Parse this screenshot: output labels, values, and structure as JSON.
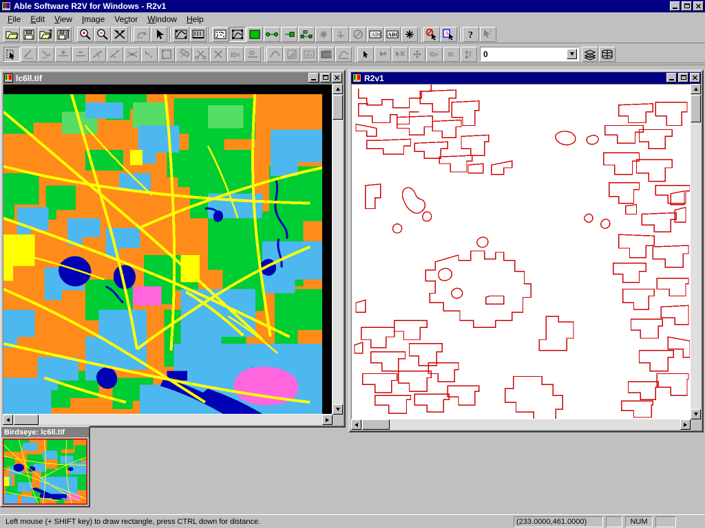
{
  "app": {
    "title": "Able Software R2V for Windows - R2v1",
    "icon": "app-icon",
    "window_buttons": {
      "minimize": "_",
      "maximize": "□",
      "close": "✕"
    }
  },
  "menu": {
    "items": [
      {
        "label": "File",
        "accel": "F"
      },
      {
        "label": "Edit",
        "accel": "E"
      },
      {
        "label": "View",
        "accel": "V"
      },
      {
        "label": "Image",
        "accel": "I"
      },
      {
        "label": "Vector",
        "accel": "c"
      },
      {
        "label": "Window",
        "accel": "W"
      },
      {
        "label": "Help",
        "accel": "H"
      }
    ]
  },
  "toolbar_row1": {
    "buttons": [
      {
        "name": "open-image-button",
        "icon": "open-folder-icon",
        "state": "enabled"
      },
      {
        "name": "save-image-button",
        "icon": "floppy-disk-icon",
        "state": "enabled"
      },
      {
        "name": "open-vector-button",
        "icon": "open-folder-vector-icon",
        "state": "enabled"
      },
      {
        "name": "save-vector-button",
        "icon": "floppy-disk-vector-icon",
        "state": "enabled"
      },
      {
        "name": "sep1",
        "icon": "separator"
      },
      {
        "name": "zoom-in-button",
        "icon": "magnifier-plus-icon",
        "state": "enabled"
      },
      {
        "name": "zoom-out-button",
        "icon": "magnifier-minus-icon",
        "state": "enabled"
      },
      {
        "name": "zoom-fit-button",
        "icon": "zoom-fit-icon",
        "state": "enabled"
      },
      {
        "name": "sep2",
        "icon": "separator"
      },
      {
        "name": "undo-button",
        "icon": "undo-arrow-icon",
        "state": "disabled"
      },
      {
        "name": "pointer-select-button",
        "icon": "arrow-pointer-icon",
        "state": "enabled"
      },
      {
        "name": "sep3",
        "icon": "separator"
      },
      {
        "name": "auto-vectorize-button",
        "icon": "vectorize-icon",
        "state": "enabled"
      },
      {
        "name": "raster-editing-button",
        "icon": "raster-edit-icon",
        "state": "enabled"
      },
      {
        "name": "sep4",
        "icon": "separator"
      },
      {
        "name": "show-raster-button",
        "icon": "raster-dots-icon",
        "state": "enabled"
      },
      {
        "name": "show-vector-button",
        "icon": "vector-frame-icon",
        "state": "pressed"
      },
      {
        "name": "show-color-button",
        "icon": "green-square-icon",
        "state": "enabled"
      },
      {
        "name": "show-lines-button",
        "icon": "line-nodes-icon",
        "state": "enabled"
      },
      {
        "name": "show-single-line-button",
        "icon": "single-node-icon",
        "state": "enabled"
      },
      {
        "name": "show-line-id-button",
        "icon": "line-id-icon",
        "state": "enabled"
      },
      {
        "name": "show-points-button",
        "icon": "points-icon",
        "state": "disabled"
      },
      {
        "name": "show-control-points-button",
        "icon": "control-point-icon",
        "state": "disabled"
      },
      {
        "name": "no-entry-button",
        "icon": "no-entry-icon",
        "state": "disabled"
      },
      {
        "name": "show-text-button",
        "icon": "text-box-icon",
        "state": "enabled"
      },
      {
        "name": "show-abc-button",
        "icon": "abc-icon",
        "state": "enabled"
      },
      {
        "name": "show-node-button",
        "icon": "star-node-icon",
        "state": "enabled"
      },
      {
        "name": "sep5",
        "icon": "separator"
      },
      {
        "name": "delete-select-button",
        "icon": "delete-pointer-icon",
        "state": "enabled"
      },
      {
        "name": "attribute-select-button",
        "icon": "attribute-pointer-icon",
        "state": "enabled"
      },
      {
        "name": "sep6",
        "icon": "separator"
      },
      {
        "name": "help-button",
        "icon": "question-mark-icon",
        "state": "enabled"
      },
      {
        "name": "context-help-button",
        "icon": "arrow-question-icon",
        "state": "disabled"
      }
    ]
  },
  "toolbar_row2": {
    "buttons": [
      {
        "name": "edit-select-tool",
        "icon": "hand-pointer-icon",
        "state": "pressed"
      },
      {
        "name": "draw-line-tool",
        "icon": "draw-line-icon",
        "state": "disabled"
      },
      {
        "name": "add-vertex-tool",
        "icon": "add-vertex-icon",
        "state": "disabled"
      },
      {
        "name": "add-node-tool",
        "icon": "add-node-plus-icon",
        "state": "disabled"
      },
      {
        "name": "delete-node-tool",
        "icon": "delete-node-minus-icon",
        "state": "disabled"
      },
      {
        "name": "split-line-tool",
        "icon": "split-line-icon",
        "state": "disabled"
      },
      {
        "name": "join-line-tool",
        "icon": "join-line-icon",
        "state": "disabled"
      },
      {
        "name": "connect-lines-tool",
        "icon": "connect-lines-icon",
        "state": "disabled"
      },
      {
        "name": "move-line-tool",
        "icon": "move-line-icon",
        "state": "disabled"
      },
      {
        "name": "close-polygon-tool",
        "icon": "polygon-icon",
        "state": "disabled"
      },
      {
        "name": "measure-tool",
        "icon": "measure-icon",
        "state": "disabled"
      },
      {
        "name": "cut-line-tool",
        "icon": "scissors-icon",
        "state": "disabled"
      },
      {
        "name": "delete-line-tool",
        "icon": "x-delete-icon",
        "state": "disabled"
      },
      {
        "name": "set-id-tool",
        "icon": "id-equals-icon",
        "state": "disabled"
      },
      {
        "name": "id-label-tool",
        "icon": "id-label-icon",
        "state": "disabled"
      },
      {
        "name": "sep1",
        "icon": "separator"
      },
      {
        "name": "smooth-line-tool",
        "icon": "smooth-line-icon",
        "state": "disabled"
      },
      {
        "name": "hatch-tool",
        "icon": "hatch-icon",
        "state": "disabled"
      },
      {
        "name": "text-tool",
        "icon": "abc-text-icon",
        "state": "disabled"
      },
      {
        "name": "fill-tool",
        "icon": "fill-region-icon",
        "state": "disabled"
      },
      {
        "name": "contour-tool",
        "icon": "contour-icon",
        "state": "disabled"
      },
      {
        "name": "sep2",
        "icon": "separator"
      },
      {
        "name": "point-select-tool",
        "icon": "small-pointer-icon",
        "state": "enabled"
      },
      {
        "name": "add-point-tool",
        "icon": "add-point-icon",
        "state": "disabled"
      },
      {
        "name": "delete-point-tool",
        "icon": "delete-point-icon",
        "state": "disabled"
      },
      {
        "name": "move-point-tool",
        "icon": "move-point-icon",
        "state": "disabled"
      },
      {
        "name": "point-id-tool",
        "icon": "point-id-equals-icon",
        "state": "disabled"
      },
      {
        "name": "point-label-tool",
        "icon": "point-id-icon",
        "state": "disabled"
      },
      {
        "name": "point-attr-tool",
        "icon": "point-attribute-icon",
        "state": "disabled"
      }
    ],
    "layer_combo": {
      "value": "0",
      "placeholder": "0"
    },
    "after_combo": [
      {
        "name": "layer-stack-button",
        "icon": "layers-icon",
        "state": "enabled"
      },
      {
        "name": "layer-properties-button",
        "icon": "layer-props-icon",
        "state": "enabled"
      }
    ]
  },
  "windows": {
    "image_window": {
      "title": "lc6ll.tif",
      "active": false,
      "buttons": {
        "minimize": "_",
        "maximize": "□",
        "close": "✕"
      }
    },
    "vector_window": {
      "title": "R2v1",
      "active": true,
      "buttons": {
        "minimize": "_",
        "maximize": "□",
        "close": "✕"
      }
    }
  },
  "birdseye": {
    "title": "Birdseye: lc6ll.tif"
  },
  "statusbar": {
    "message": "Left mouse (+ SHIFT key) to draw rectangle, press CTRL down for distance.",
    "coordinates": "(233.0000,461.0000)",
    "pane_blank_1": "",
    "num_indicator": "NUM",
    "pane_blank_2": ""
  },
  "colors": {
    "titlebar_active": "#000080",
    "titlebar_inactive": "#808080",
    "face": "#c0c0c0",
    "vector_line": "#cc0000",
    "landcover_orange": "#ff8c1a",
    "landcover_green": "#00cc33",
    "landcover_lightgreen": "#55dd66",
    "landcover_cyan": "#4cb8ef",
    "landcover_yellow": "#ffff00",
    "landcover_darkblue": "#0000b4",
    "landcover_magenta": "#ff66dd"
  }
}
